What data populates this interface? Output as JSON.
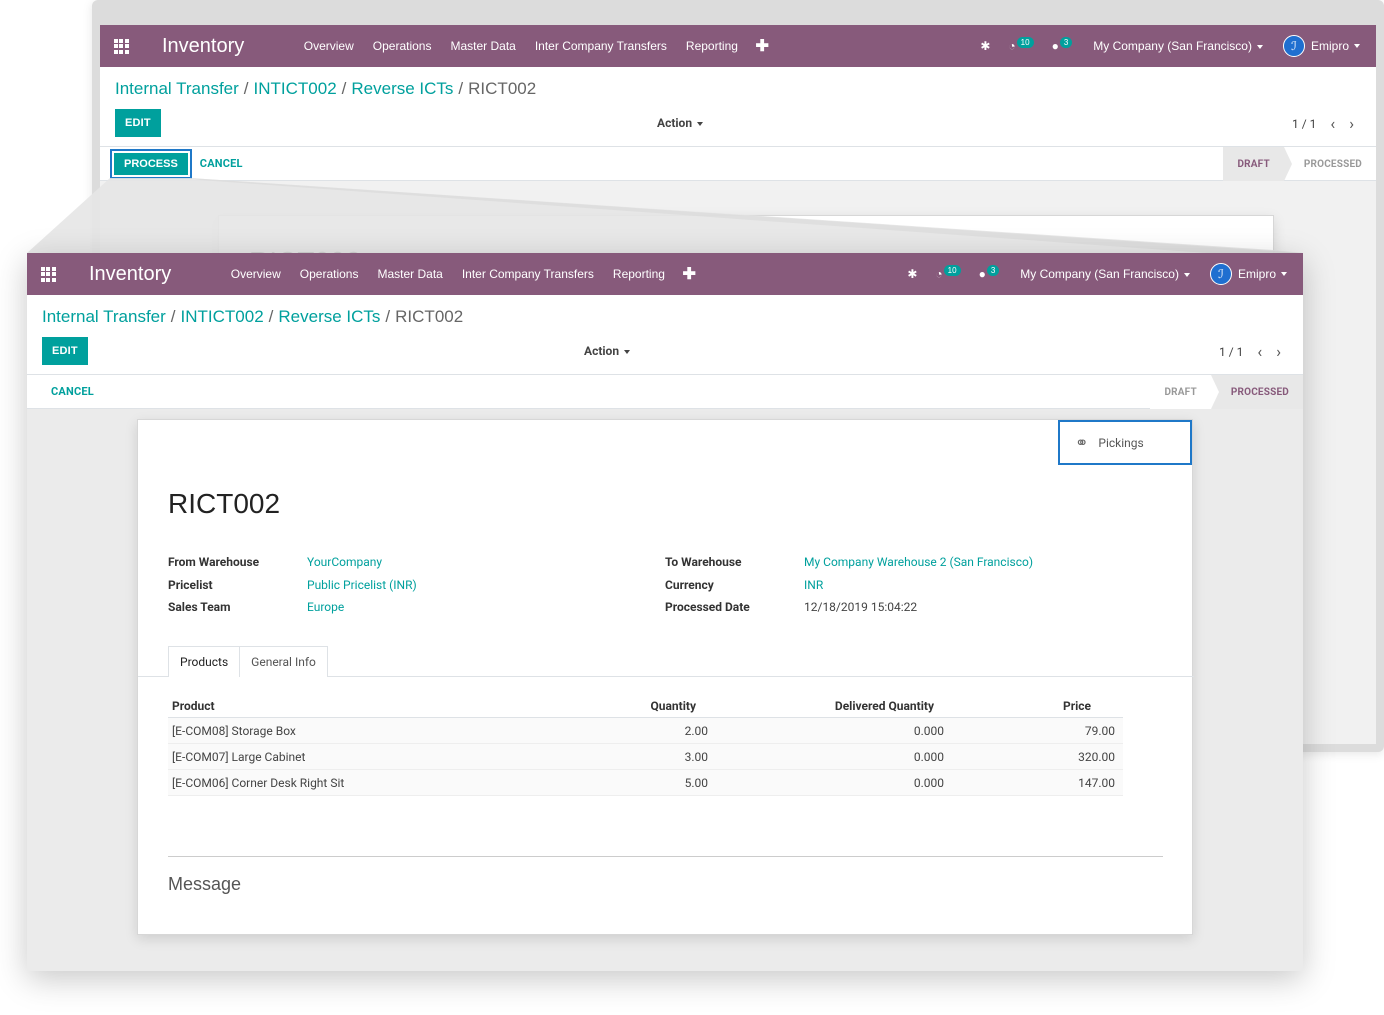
{
  "app": {
    "brand": "Inventory",
    "menu": [
      "Overview",
      "Operations",
      "Master Data",
      "Inter Company Transfers",
      "Reporting"
    ],
    "activity_count": "10",
    "message_count": "3",
    "company": "My Company (San Francisco)",
    "user": "Emipro"
  },
  "breadcrumb": {
    "items": [
      "Internal Transfer",
      "INTICT002",
      "Reverse ICTs"
    ],
    "current": "RICT002"
  },
  "toolbar": {
    "edit_label": "EDIT",
    "action_label": "Action",
    "pager": "1 / 1"
  },
  "back_window": {
    "process_label": "PROCESS",
    "cancel_label": "CANCEL",
    "steps": [
      "DRAFT",
      "PROCESSED"
    ],
    "active_step": "DRAFT",
    "record_title": "RICT002"
  },
  "front_window": {
    "cancel_label": "CANCEL",
    "steps": [
      "DRAFT",
      "PROCESSED"
    ],
    "active_step": "PROCESSED",
    "smart_button": "Pickings",
    "record_title": "RICT002",
    "fields_left": [
      {
        "label": "From Warehouse",
        "value": "YourCompany"
      },
      {
        "label": "Pricelist",
        "value": "Public Pricelist (INR)"
      },
      {
        "label": "Sales Team",
        "value": "Europe"
      }
    ],
    "fields_right": [
      {
        "label": "To Warehouse",
        "value": "My Company Warehouse 2 (San Francisco)"
      },
      {
        "label": "Currency",
        "value": "INR"
      },
      {
        "label": "Processed Date",
        "value": "12/18/2019 15:04:22"
      }
    ],
    "tabs": [
      "Products",
      "General Info"
    ],
    "table": {
      "headers": [
        "Product",
        "Quantity",
        "Delivered Quantity",
        "Price"
      ],
      "rows": [
        [
          "[E-COM08] Storage Box",
          "2.00",
          "0.000",
          "79.00"
        ],
        [
          "[E-COM07] Large Cabinet",
          "3.00",
          "0.000",
          "320.00"
        ],
        [
          "[E-COM06] Corner Desk Right Sit",
          "5.00",
          "0.000",
          "147.00"
        ]
      ]
    },
    "message_label": "Message"
  },
  "colors": {
    "navbar": "#875a7b",
    "accent": "#00a09d",
    "highlight": "#1f78c8"
  }
}
